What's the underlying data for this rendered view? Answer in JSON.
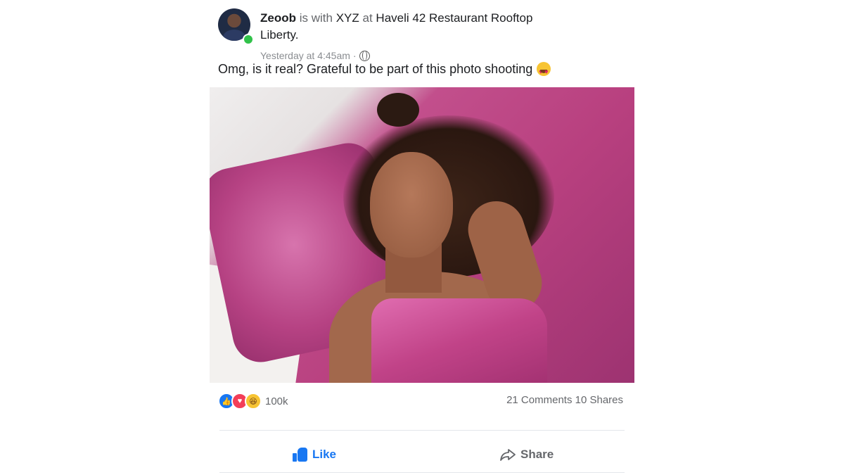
{
  "post": {
    "author": "Zeoob",
    "with_text": "is with",
    "tagged": "XYZ",
    "at_text": "at",
    "location_line1": "Haveli 42 Restaurant Rooftop",
    "location_line2": "Liberty.",
    "timestamp": "Yesterday at 4:45am",
    "separator": "·",
    "privacy_icon": "globe-icon",
    "caption": "Omg, is it real? Grateful to be part of this photo shooting",
    "caption_emoji": "heart-eyes-emoji",
    "author_online": true
  },
  "engagement": {
    "reaction_icons": [
      "like-reaction-icon",
      "love-reaction-icon",
      "haha-reaction-icon"
    ],
    "reaction_count": "100k",
    "comments_shares": "21 Comments 10 Shares"
  },
  "actions": {
    "like_label": "Like",
    "share_label": "Share"
  },
  "colors": {
    "accent": "#1877f2",
    "muted": "#65676b",
    "online": "#31c24a"
  }
}
